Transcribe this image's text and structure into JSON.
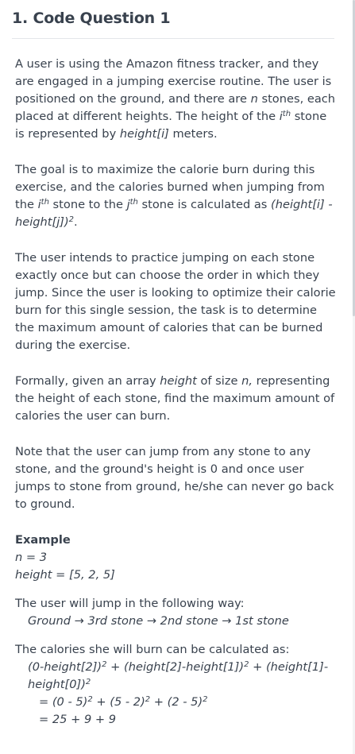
{
  "question": {
    "title": "1. Code Question 1"
  },
  "p1": {
    "a": "A user is using the Amazon fitness tracker, and they are engaged in a jumping exercise routine. The user is positioned on the ground, and there are ",
    "n": "n",
    "b": " stones, each placed at different heights. The height of the ",
    "i": "i",
    "th": "th",
    "c": " stone is represented by ",
    "hi": "height[i]",
    "d": " meters."
  },
  "p2": {
    "a": "The goal is to maximize the calorie burn during this exercise, and the calories burned when jumping from the ",
    "i": "i",
    "th1": "th",
    "b": " stone to the ",
    "j": "j",
    "th2": "th",
    "c": " stone is calculated as ",
    "formula": "(height[i] - height[j])",
    "sq": "2",
    "d": "."
  },
  "p3": {
    "text": "The user intends to practice jumping on each stone exactly once but can choose the order in which they jump. Since the user is looking to optimize their calorie burn for this single session, the task is to determine the maximum amount of calories that can be burned during the exercise."
  },
  "p4": {
    "a": "Formally, given an array ",
    "height": "height",
    "b": " of size ",
    "n": "n,",
    "c": " representing the height of each stone, find the maximum amount of calories the user can burn."
  },
  "p5": {
    "text": "Note that the user can jump from any stone to any stone, and the ground's height is 0 and once user jumps to stone from ground, he/she can never go back to ground."
  },
  "example": {
    "heading": "Example",
    "n_line": "n = 3",
    "height_line": "height = [5, 2, 5]",
    "jump_intro": "The user will jump in the following way:",
    "jump_path": "Ground → 3rd stone → 2nd stone → 1st stone",
    "calc_intro": "The calories she will burn can be calculated as:",
    "calc_a1": "(0-height[2])",
    "calc_a2": " + (height[2]-height[1])",
    "calc_a3": " + (height[1]-height[0])",
    "sq": "2",
    "calc_b1": "= (0 - 5)",
    "calc_b2": " + (5 - 2)",
    "calc_b3": " + (2 - 5)",
    "calc_c": "= 25 + 9 + 9"
  }
}
